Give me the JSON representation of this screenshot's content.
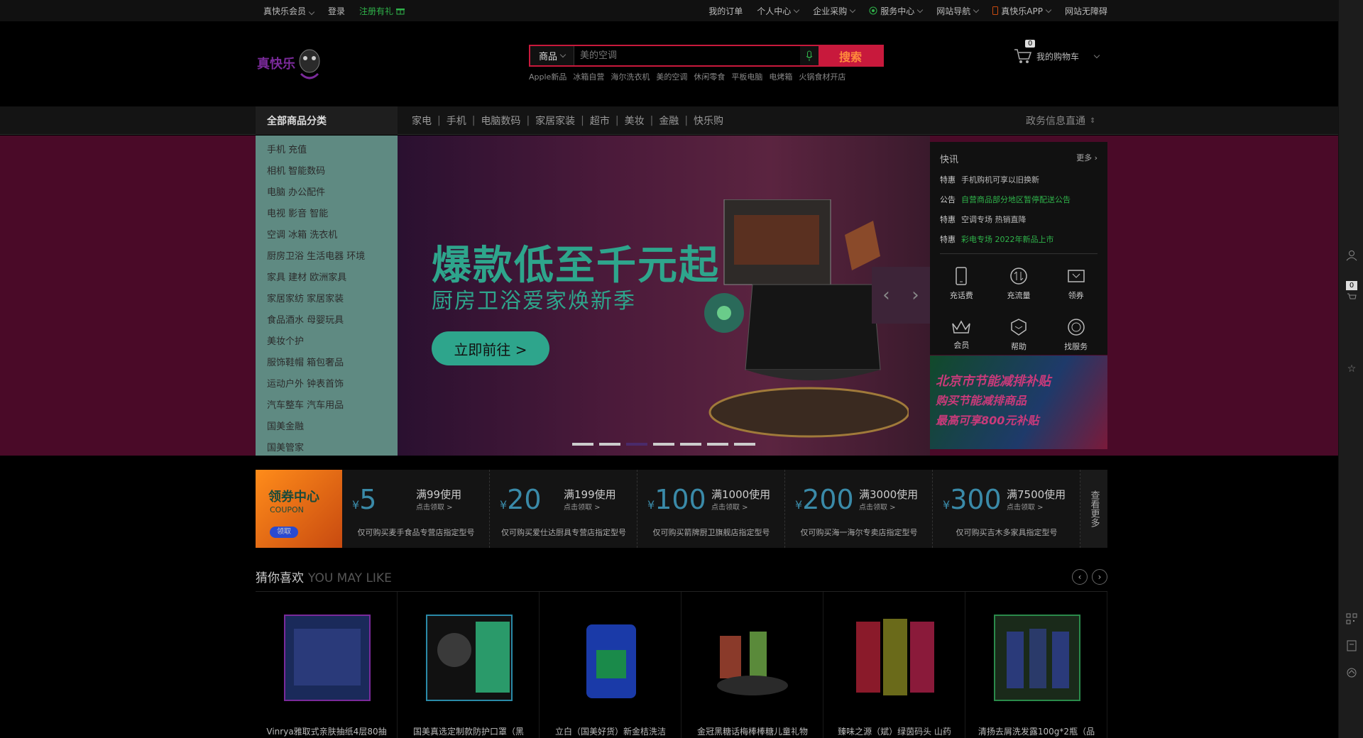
{
  "topbar": {
    "member": "真快乐会员",
    "login": "登录",
    "register": "注册有礼",
    "right": [
      "我的订单",
      "个人中心",
      "企业采购",
      "服务中心",
      "网站导航",
      "真快乐APP",
      "网站无障碍"
    ]
  },
  "logo": {
    "text": "真快乐"
  },
  "search": {
    "scope": "商品",
    "placeholder": "美的空调",
    "button": "搜索",
    "hotwords": [
      "Apple新品",
      "冰箱自营",
      "海尔洗衣机",
      "美的空调",
      "休闲零食",
      "平板电脑",
      "电烤箱",
      "火锅食材开店"
    ]
  },
  "cart": {
    "label": "我的购物车",
    "count": "0"
  },
  "nav": {
    "all_categories": "全部商品分类",
    "links": [
      "家电",
      "手机",
      "电脑数码",
      "家居家装",
      "超市",
      "美妆",
      "金融",
      "快乐购"
    ],
    "gov": "政务信息直通"
  },
  "categories": [
    "手机 充值",
    "相机 智能数码",
    "电脑 办公配件",
    "电视 影音 智能",
    "空调 冰箱 洗衣机",
    "厨房卫浴 生活电器 环境",
    "家具 建材 欧洲家具",
    "家居家纺 家居家装",
    "食品酒水 母婴玩具",
    "美妆个护",
    "服饰鞋帽 箱包奢品",
    "运动户外 钟表首饰",
    "汽车整车 汽车用品",
    "国美金融",
    "国美管家"
  ],
  "hero": {
    "headline": "爆款低至千元起",
    "subline": "厨房卫浴爱家焕新季",
    "cta": "立即前往 >",
    "dots": 7,
    "active_dot": 2
  },
  "news": {
    "title": "快讯",
    "more": "更多",
    "items": [
      {
        "tag": "特惠",
        "text": "手机购机可享以旧换新",
        "green": false
      },
      {
        "tag": "公告",
        "text": "自营商品部分地区暂停配送公告",
        "green": true
      },
      {
        "tag": "特惠",
        "text": "空调专场 热销直降",
        "green": false
      },
      {
        "tag": "特惠",
        "text": "彩电专场 2022年新品上市",
        "green": true
      }
    ],
    "services": [
      "充话费",
      "充流量",
      "领券",
      "会员",
      "帮助",
      "找服务"
    ]
  },
  "ad": {
    "lines": [
      "北京市节能减排补贴",
      "购买节能减排商品",
      "最高可享800元补贴"
    ]
  },
  "coupons": {
    "center_title": "领券中心",
    "center_sub": "COUPON",
    "center_btn": "领取",
    "items": [
      {
        "amount": "5",
        "cond": "满99使用",
        "click": "点击领取 >",
        "desc": "仅可购买麦手食品专营店指定型号"
      },
      {
        "amount": "20",
        "cond": "满199使用",
        "click": "点击领取 >",
        "desc": "仅可购买爱仕达厨具专营店指定型号"
      },
      {
        "amount": "100",
        "cond": "满1000使用",
        "click": "点击领取 >",
        "desc": "仅可购买箭牌厨卫旗舰店指定型号"
      },
      {
        "amount": "200",
        "cond": "满3000使用",
        "click": "点击领取 >",
        "desc": "仅可购买海一海尔专卖店指定型号"
      },
      {
        "amount": "300",
        "cond": "满7500使用",
        "click": "点击领取 >",
        "desc": "仅可购买吉木多家具指定型号"
      }
    ],
    "more": "查看更多",
    "currency": "¥"
  },
  "maylike": {
    "title": "猜你喜欢",
    "en": "YOU MAY LIKE",
    "products": [
      "Vinrya雅取式亲肤抽纸4层80抽",
      "国美真选定制款防护口罩（黑",
      "立白（国美好货）新金桔洗洁",
      "金冠黑糖话梅棒棒糖儿童礼物",
      "臻味之源（斌）绿茵码头 山药",
      "清扬去屑洗发露100g*2瓶（品"
    ]
  },
  "colors": {
    "accent": "#c8193c",
    "teal": "#2ea58c",
    "green": "#2fb34a"
  }
}
